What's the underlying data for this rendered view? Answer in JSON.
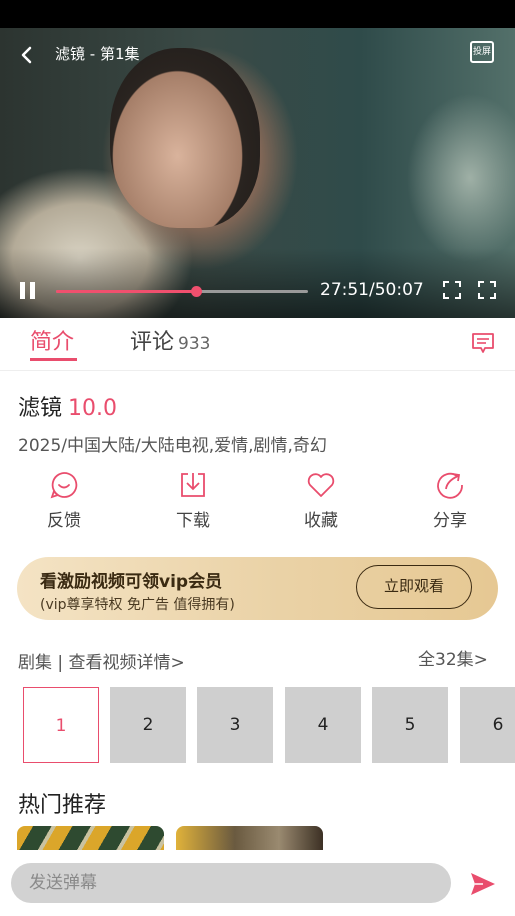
{
  "player": {
    "title": "滤镜 - 第1集",
    "cast_label": "投屏",
    "current_time": "27:51",
    "total_time": "50:07",
    "time_display": "27:51/50:07",
    "progress": 0.556
  },
  "tabs": {
    "intro_label": "简介",
    "comment_label": "评论",
    "comment_count": "933"
  },
  "show": {
    "title": "滤镜",
    "score": "10.0",
    "meta": "2025/中国大陆/大陆电视,爱情,剧情,奇幻"
  },
  "actions": {
    "feedback": "反馈",
    "download": "下载",
    "favorite": "收藏",
    "share": "分享"
  },
  "vip": {
    "title": "看激励视频可领vip会员",
    "subtitle": "(vip尊享特权 免广告 值得拥有)",
    "button": "立即观看"
  },
  "episodes": {
    "heading": "剧集 | 查看视频详情>",
    "all_label": "全32集>",
    "items": [
      "1",
      "2",
      "3",
      "4",
      "5",
      "6"
    ],
    "selected": "1"
  },
  "recommend": {
    "title": "热门推荐"
  },
  "danmaku": {
    "placeholder": "发送弹幕"
  },
  "colors": {
    "accent": "#e94d6d",
    "progress": "#f0506e",
    "vip_gold": "#ead2a6"
  }
}
